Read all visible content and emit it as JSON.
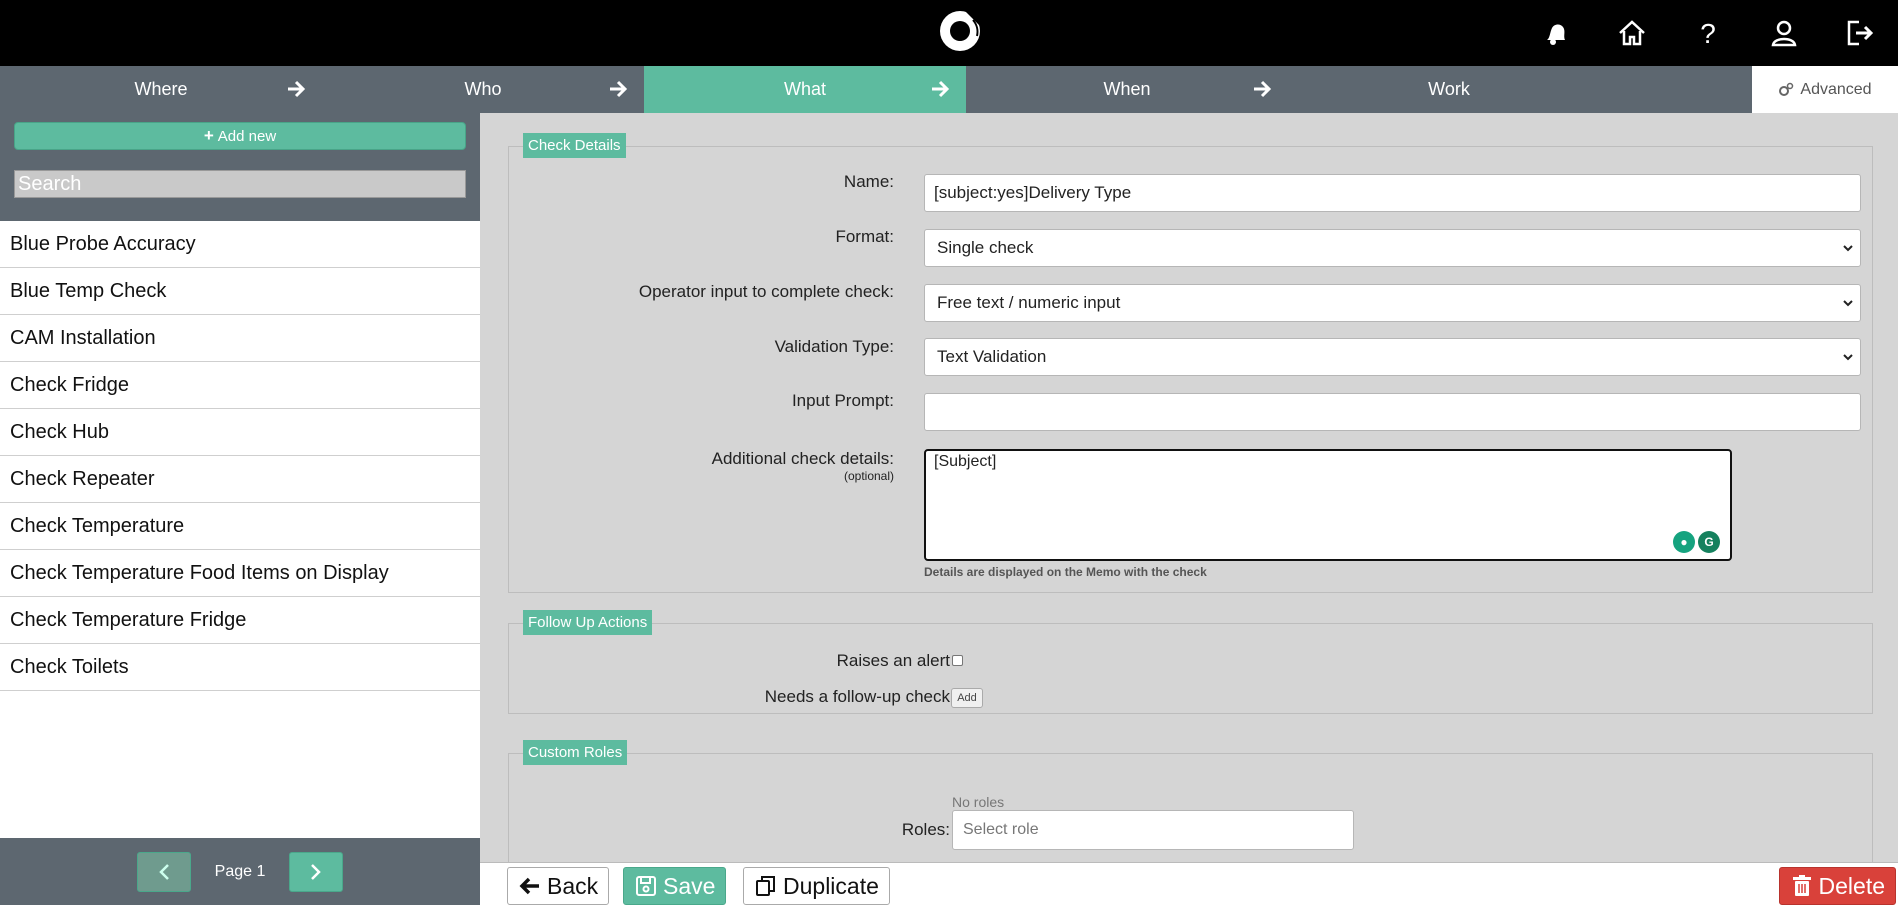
{
  "header": {
    "icons": [
      "logo-icon",
      "notification-bell-icon",
      "home-icon",
      "help-icon",
      "user-icon",
      "logout-icon"
    ]
  },
  "wizard": {
    "steps": [
      {
        "label": "Where"
      },
      {
        "label": "Who"
      },
      {
        "label": "What"
      },
      {
        "label": "When"
      },
      {
        "label": "Work"
      }
    ],
    "active": "What",
    "advanced_label": "Advanced"
  },
  "sidebar": {
    "add_new_label": "Add new",
    "search_placeholder": "Search",
    "items": [
      "Blue Probe Accuracy",
      "Blue Temp Check",
      "CAM Installation",
      "Check Fridge",
      "Check Hub",
      "Check Repeater",
      "Check Temperature",
      "Check Temperature Food Items on Display",
      "Check Temperature Fridge",
      "Check Toilets"
    ],
    "pager": {
      "label": "Page 1"
    }
  },
  "check_details": {
    "legend": "Check Details",
    "name_label": "Name:",
    "name_value": "[subject:yes]Delivery Type",
    "format_label": "Format:",
    "format_value": "Single check",
    "operator_label": "Operator input to complete check:",
    "operator_value": "Free text / numeric input",
    "validation_label": "Validation Type:",
    "validation_value": "Text Validation",
    "prompt_label": "Input Prompt:",
    "prompt_value": "",
    "additional_label": "Additional check details:",
    "additional_optional": "(optional)",
    "additional_value": "[Subject]",
    "additional_help": "Details are displayed on the Memo with the check"
  },
  "follow_up": {
    "legend": "Follow Up Actions",
    "alert_label": "Raises an alert",
    "followup_label": "Needs a follow-up check",
    "add_label": "Add"
  },
  "custom_roles": {
    "legend": "Custom Roles",
    "no_roles": "No roles",
    "roles_label": "Roles:",
    "select_placeholder": "Select role"
  },
  "footer": {
    "back_label": "Back",
    "save_label": "Save",
    "duplicate_label": "Duplicate",
    "delete_label": "Delete"
  },
  "colors": {
    "accent": "#5dbb9f",
    "nav": "#5d6770",
    "danger": "#d9413a"
  }
}
